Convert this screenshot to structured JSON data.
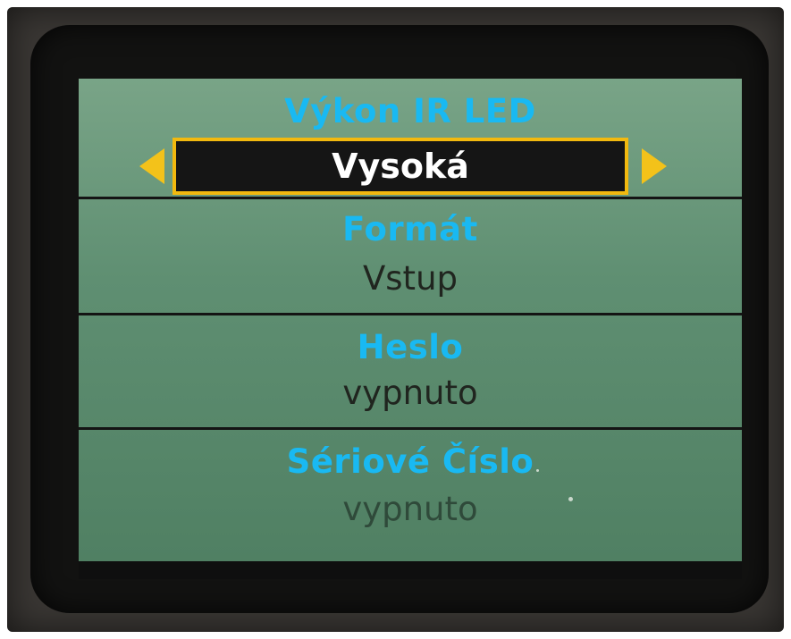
{
  "menu": {
    "items": [
      {
        "label": "Výkon IR LED",
        "value": "Vysoká",
        "selected": true
      },
      {
        "label": "Formát",
        "value": "Vstup"
      },
      {
        "label": "Heslo",
        "value": "vypnuto"
      },
      {
        "label": "Sériové Číslo",
        "value": "vypnuto"
      }
    ]
  },
  "colors": {
    "label": "#19b9f2",
    "selection_border": "#f2b90f",
    "screen": "#5b8a6f"
  }
}
